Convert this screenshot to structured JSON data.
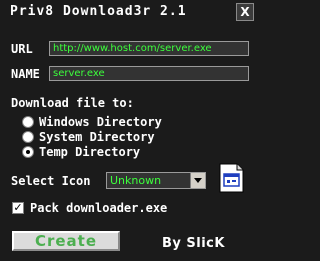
{
  "window": {
    "title": "Priv8 Download3r 2.1",
    "close_glyph": "X"
  },
  "url": {
    "label": "URL",
    "value": "http://www.host.com/server.exe"
  },
  "name": {
    "label": "NAME",
    "value": "server.exe"
  },
  "download": {
    "heading": "Download file to:",
    "options": [
      {
        "label": "Windows Directory",
        "checked": false
      },
      {
        "label": "System Directory",
        "checked": false
      },
      {
        "label": "Temp Directory",
        "checked": true
      }
    ]
  },
  "icon": {
    "label": "Select Icon",
    "selected": "Unknown",
    "preview_icon": "unknown-file-icon"
  },
  "pack": {
    "label": "Pack downloader.exe",
    "checked": true
  },
  "actions": {
    "create_label": "Create"
  },
  "credit": "By SlicK",
  "colors": {
    "background": "#1b1b1b",
    "field_text": "#3cff3c",
    "create_text": "#4caf50"
  }
}
